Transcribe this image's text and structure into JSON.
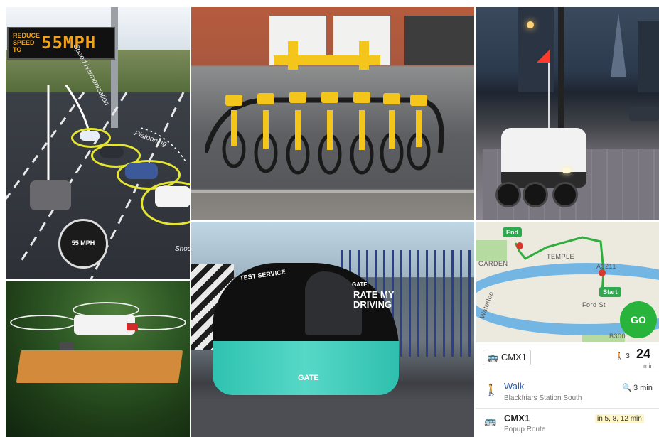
{
  "highway": {
    "sign_small": "REDUCE SPEED TO",
    "sign_speed": "55MPH",
    "label_speed_harmonization": "Speed Harmonization",
    "label_platooning": "Platooning",
    "label_shockwave": "Shoc",
    "gauge_speed": "55 MPH"
  },
  "pod": {
    "top_text": "TEST SERVICE",
    "side_text_1": "RATE MY",
    "side_text_2": "DRIVING",
    "brand_front": "GATE",
    "brand_side": "GATE",
    "livery_text": "GATE"
  },
  "app": {
    "map_labels": {
      "end": "End",
      "start": "Start",
      "garden": "GARDEN",
      "temple": "TEMPLE",
      "waterloo": "Waterloo",
      "b300": "B300",
      "a3211": "A3211",
      "road": "Ford St"
    },
    "go_label": "GO",
    "route_header": {
      "route_name": "CMX1",
      "walk_count": "3",
      "eta_value": "24",
      "eta_unit": "min"
    },
    "walk_step": {
      "title": "Walk",
      "subtitle": "Blackfriars Station South",
      "duration": "3 min"
    },
    "bus_step": {
      "title": "CMX1",
      "subtitle": "Popup Route",
      "frequency": "in 5, 8, 12 min"
    },
    "colors": {
      "accent_green": "#28b33b",
      "river": "#74b6e3"
    }
  }
}
